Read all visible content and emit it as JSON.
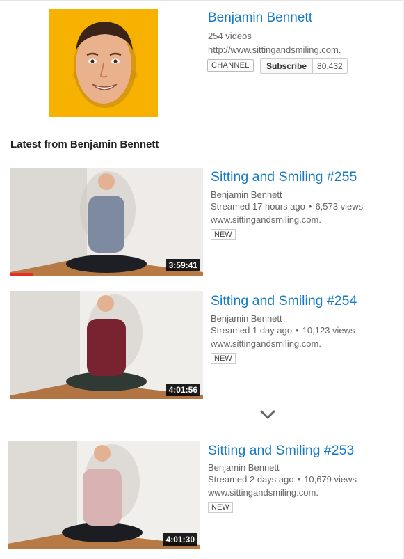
{
  "channel": {
    "name": "Benjamin Bennett",
    "video_count": "254 videos",
    "url": "http://www.sittingandsmiling.com.",
    "badge": "CHANNEL",
    "subscribe_label": "Subscribe",
    "subscriber_count": "80,432",
    "avatar_bg": "#f7b100"
  },
  "section": {
    "title": "Latest from Benjamin Bennett"
  },
  "videos": [
    {
      "title": "Sitting and Smiling #255",
      "channel": "Benjamin Bennett",
      "streamed": "Streamed 17 hours ago",
      "views": "6,573 views",
      "url": "www.sittingandsmiling.com.",
      "badge": "NEW",
      "duration": "3:59:41",
      "watched_fraction": 0.12,
      "shirt_color": "#7d8aa0"
    },
    {
      "title": "Sitting and Smiling #254",
      "channel": "Benjamin Bennett",
      "streamed": "Streamed 1 day ago",
      "views": "10,123 views",
      "url": "www.sittingandsmiling.com.",
      "badge": "NEW",
      "duration": "4:01:56",
      "shirt_color": "#7a2330"
    },
    {
      "title": "Sitting and Smiling #253",
      "channel": "Benjamin Bennett",
      "streamed": "Streamed 2 days ago",
      "views": "10,679 views",
      "url": "www.sittingandsmiling.com.",
      "badge": "NEW",
      "duration": "4:01:30",
      "shirt_color": "#d9b3b3"
    }
  ],
  "icons": {
    "expand": "chevron-down-icon",
    "meta_separator": "•"
  },
  "colors": {
    "link_blue": "#167ac6",
    "progress_red": "#e52d27",
    "avatar_yellow": "#f7b100"
  }
}
